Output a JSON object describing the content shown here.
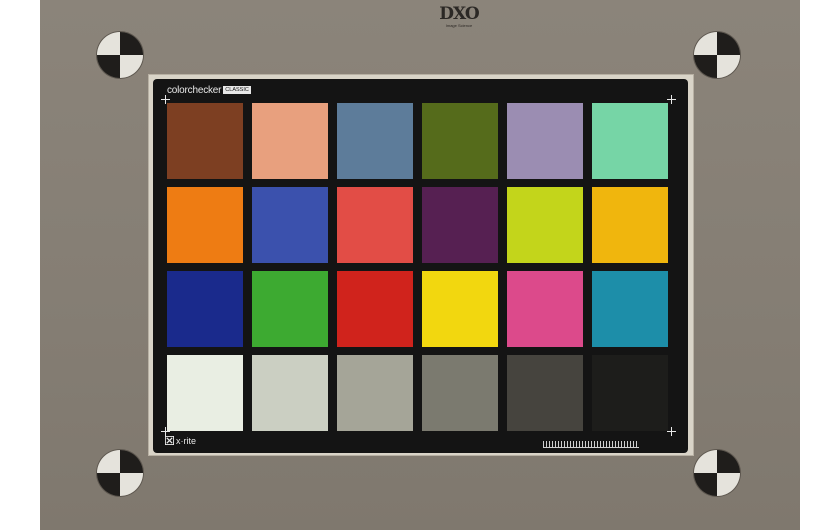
{
  "header_logo": {
    "text": "DXO",
    "subtext": "Image Science"
  },
  "chart": {
    "title": "colorchecker",
    "tag": "CLASSIC",
    "footer_logo_text": "x·rite",
    "icons": {
      "registration_targets": "quadrant-target-icon",
      "corner_marks": "crosshair-icon",
      "footer": "xrite-icon",
      "ruler": "scale-ruler"
    },
    "patch_colors": [
      [
        "#7d3f22",
        "#e8a07e",
        "#5d7c9a",
        "#556b1b",
        "#9b8db2",
        "#76d5a6"
      ],
      [
        "#ee7c13",
        "#3b51ad",
        "#e24d46",
        "#562052",
        "#c3d51b",
        "#f0b60d"
      ],
      [
        "#1a2a8c",
        "#3daa31",
        "#d0231c",
        "#f2d70f",
        "#dc4a8b",
        "#1d8ea9"
      ],
      [
        "#e9eee3",
        "#cbcfc2",
        "#a5a598",
        "#7b7a6f",
        "#46443e",
        "#1d1d1b"
      ]
    ]
  },
  "colors": {
    "board": "#857e74",
    "mount": "#d9d4c8",
    "card": "#141414"
  }
}
